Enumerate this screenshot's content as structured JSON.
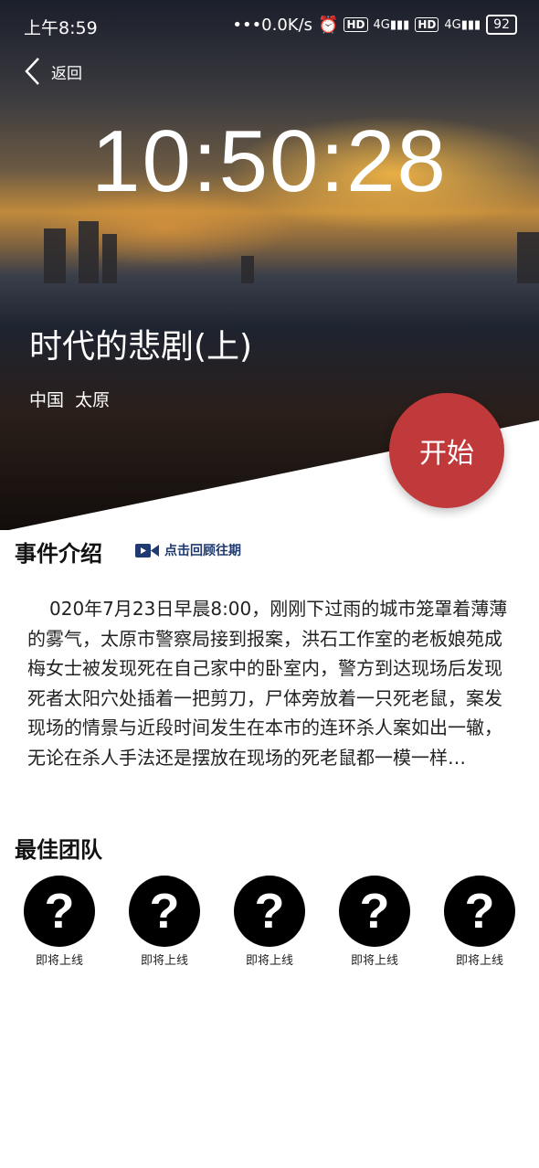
{
  "status_bar": {
    "time": "上午8:59",
    "network_speed": "•••0.0K/s",
    "hd1": "HD",
    "net1": "4G",
    "hd2": "HD",
    "net2": "4G",
    "battery": "92"
  },
  "header": {
    "back_label": "返回"
  },
  "hero": {
    "countdown": "10:50:28",
    "title": "时代的悲剧(上)",
    "location": "中国  太原",
    "start_label": "开始"
  },
  "intro": {
    "title": "事件介绍",
    "review_label": "点击回顾往期",
    "text": "020年7月23日早晨8:00，刚刚下过雨的城市笼罩着薄薄的雾气，太原市警察局接到报案，洪石工作室的老板娘苑成梅女士被发现死在自己家中的卧室内，警方到达现场后发现死者太阳穴处插着一把剪刀，尸体旁放着一只死老鼠，案发现场的情景与近段时间发生在本市的连环杀人案如出一辙，无论在杀人手法还是摆放在现场的死老鼠都一模一样…"
  },
  "team": {
    "title": "最佳团队",
    "members": [
      {
        "avatar": "?",
        "label": "即将上线"
      },
      {
        "avatar": "?",
        "label": "即将上线"
      },
      {
        "avatar": "?",
        "label": "即将上线"
      },
      {
        "avatar": "?",
        "label": "即将上线"
      },
      {
        "avatar": "?",
        "label": "即将上线"
      }
    ]
  },
  "colors": {
    "start_button": "#c0393b",
    "review_link": "#1e3a70"
  }
}
